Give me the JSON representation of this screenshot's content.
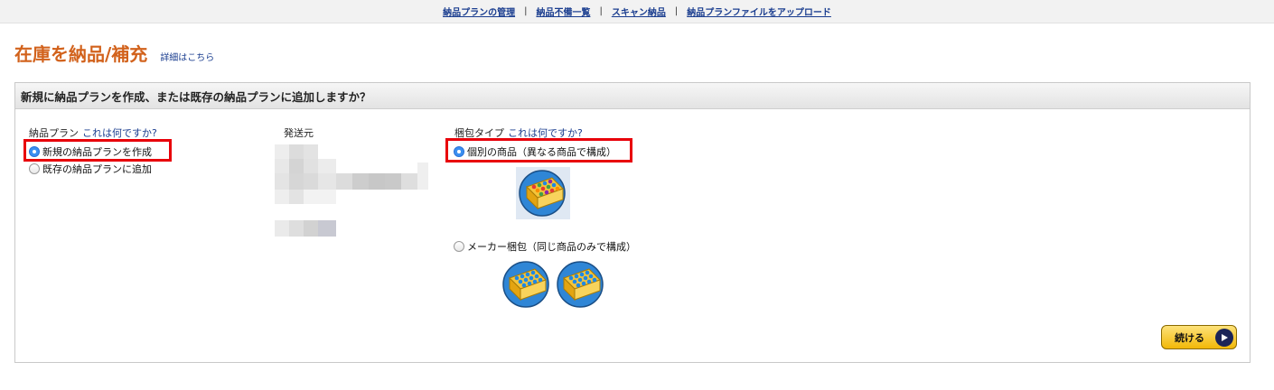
{
  "topnav": {
    "links": [
      "納品プランの管理",
      "納品不備一覧",
      "スキャン納品",
      "納品プランファイルをアップロード"
    ],
    "separator": "|"
  },
  "page": {
    "title": "在庫を納品/補充",
    "details_link": "詳細はこちら"
  },
  "panel": {
    "header": "新規に納品プランを作成、または既存の納品プランに追加しますか？"
  },
  "plan": {
    "label": "納品プラン",
    "help": "これは何ですか?",
    "options": [
      {
        "label": "新規の納品プランを作成",
        "checked": true
      },
      {
        "label": "既存の納品プランに追加",
        "checked": false
      }
    ]
  },
  "ship_from": {
    "label": "発送元"
  },
  "packing": {
    "label": "梱包タイプ",
    "help": "これは何ですか?",
    "options": [
      {
        "label": "個別の商品（異なる商品で構成）",
        "checked": true,
        "icon": "mixed-items-box-icon"
      },
      {
        "label": "メーカー梱包（同じ商品のみで構成）",
        "checked": false,
        "icon": "case-packed-box-icon"
      }
    ]
  },
  "actions": {
    "continue_label": "続ける"
  },
  "colors": {
    "title": "#d2621c",
    "link": "#1a3d8f",
    "highlight": "#e8000a",
    "button": "#f2b807"
  }
}
